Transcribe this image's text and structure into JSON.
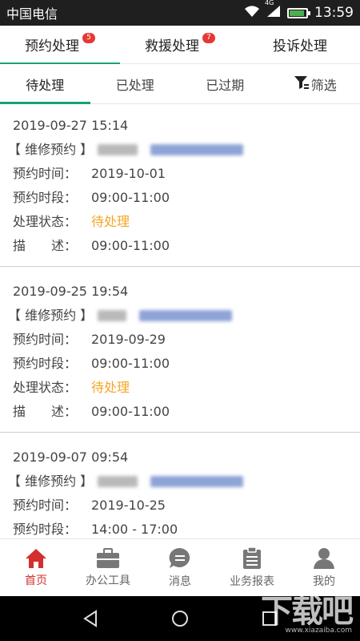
{
  "status_bar": {
    "carrier": "中国电信",
    "network": "4G",
    "time": "13:59"
  },
  "top_tabs": [
    {
      "label": "预约处理",
      "badge": "5"
    },
    {
      "label": "救援处理",
      "badge": "7"
    },
    {
      "label": "投诉处理",
      "badge": ""
    }
  ],
  "sub_tabs": [
    {
      "label": "待处理"
    },
    {
      "label": "已处理"
    },
    {
      "label": "已过期"
    }
  ],
  "filter_label": "筛选",
  "labels": {
    "appointment_time": "预约时间：",
    "appointment_slot": "预约时段：",
    "status": "处理状态：",
    "description": "描　　述："
  },
  "records": [
    {
      "created": "2019-09-27 15:14",
      "type": "【 维修预约 】",
      "date": "2019-10-01",
      "slot": "09:00-11:00",
      "status": "待处理",
      "description": "09:00-11:00"
    },
    {
      "created": "2019-09-25 19:54",
      "type": "【 维修预约 】",
      "date": "2019-09-29",
      "slot": "09:00-11:00",
      "status": "待处理",
      "description": "09:00-11:00"
    },
    {
      "created": "2019-09-07 09:54",
      "type": "【 维修预约 】",
      "date": "2019-10-25",
      "slot": "14:00 - 17:00",
      "status": "",
      "description": ""
    }
  ],
  "bottom_nav": [
    {
      "label": "首页",
      "icon": "home-icon"
    },
    {
      "label": "办公工具",
      "icon": "briefcase-icon"
    },
    {
      "label": "消息",
      "icon": "message-icon"
    },
    {
      "label": "业务报表",
      "icon": "clipboard-icon"
    },
    {
      "label": "我的",
      "icon": "person-icon"
    }
  ],
  "watermark": {
    "main": "下载吧",
    "sub": "www.xiazaiba.com"
  },
  "colors": {
    "accent": "#1aa07a",
    "status_pending": "#f5a623",
    "badge": "#e53935",
    "nav_active": "#d32f2f"
  }
}
